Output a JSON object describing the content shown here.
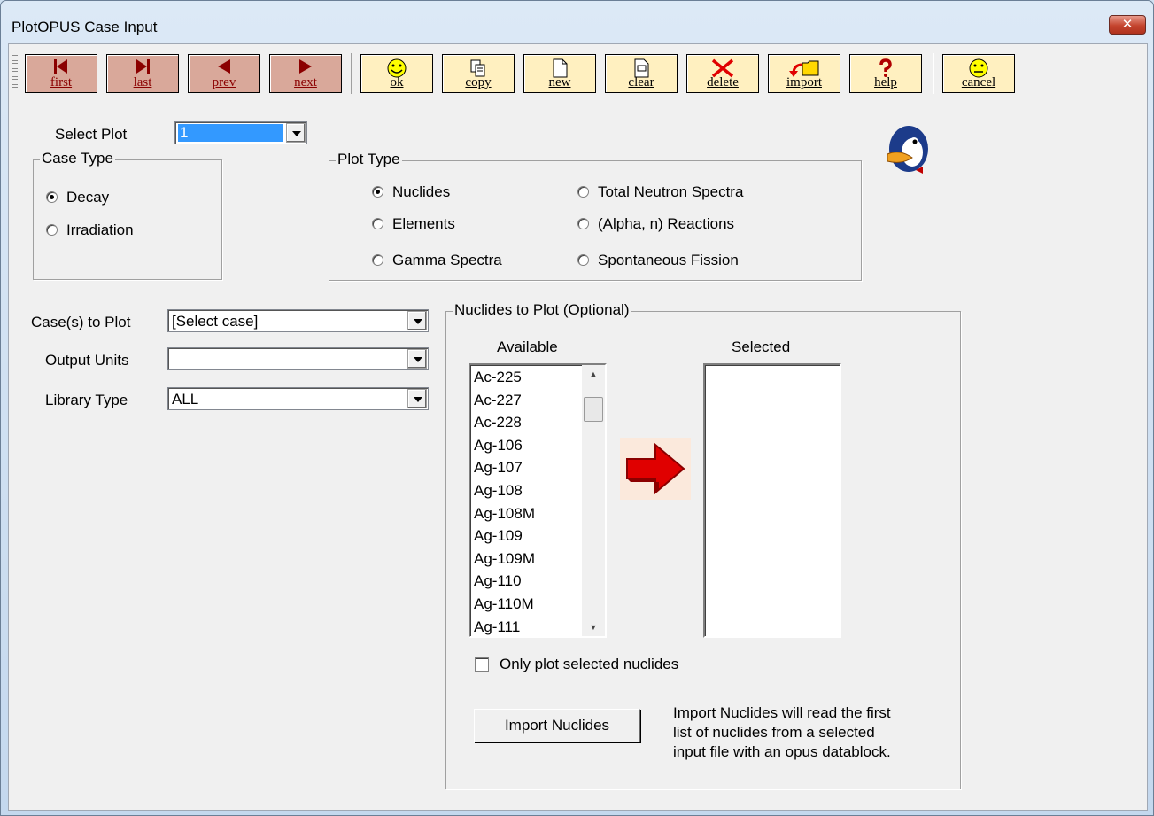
{
  "window": {
    "title": "PlotOPUS Case Input",
    "close_glyph": "✕"
  },
  "toolbar": {
    "buttons": [
      {
        "id": "first",
        "label": "first",
        "icon": "skip-first-icon"
      },
      {
        "id": "last",
        "label": "last",
        "icon": "skip-last-icon"
      },
      {
        "id": "prev",
        "label": "prev",
        "icon": "arrow-left-icon"
      },
      {
        "id": "next",
        "label": "next",
        "icon": "arrow-right-icon"
      },
      {
        "id": "ok",
        "label": "ok",
        "icon": "smiley-icon"
      },
      {
        "id": "copy",
        "label": "copy",
        "icon": "copy-icon"
      },
      {
        "id": "new",
        "label": "new",
        "icon": "new-document-icon"
      },
      {
        "id": "clear",
        "label": "clear",
        "icon": "clear-document-icon"
      },
      {
        "id": "delete",
        "label": "delete",
        "icon": "red-x-icon"
      },
      {
        "id": "import",
        "label": "import",
        "icon": "import-folder-icon"
      },
      {
        "id": "help",
        "label": "help",
        "icon": "question-mark-icon"
      },
      {
        "id": "cancel",
        "label": "cancel",
        "icon": "neutral-face-icon"
      }
    ]
  },
  "select_plot": {
    "label": "Select Plot",
    "value": "1"
  },
  "case_type": {
    "legend": "Case Type",
    "options": [
      {
        "label": "Decay",
        "checked": true
      },
      {
        "label": "Irradiation",
        "checked": false
      }
    ]
  },
  "plot_type": {
    "legend": "Plot Type",
    "options": [
      {
        "label": "Nuclides",
        "checked": true
      },
      {
        "label": "Elements",
        "checked": false
      },
      {
        "label": "Gamma Spectra",
        "checked": false
      },
      {
        "label": "Total Neutron Spectra",
        "checked": false
      },
      {
        "label": "(Alpha, n)  Reactions",
        "checked": false
      },
      {
        "label": "Spontaneous Fission",
        "checked": false
      }
    ]
  },
  "fields": {
    "cases_label": "Case(s) to Plot",
    "cases_value": "[Select case]",
    "units_label": "Output Units",
    "units_value": "",
    "library_label": "Library Type",
    "library_value": "ALL"
  },
  "nuclides": {
    "legend": "Nuclides to Plot  (Optional)",
    "available_label": "Available",
    "selected_label": "Selected",
    "available": [
      "Ac-225",
      "Ac-227",
      "Ac-228",
      "Ag-106",
      "Ag-107",
      "Ag-108",
      "Ag-108M",
      "Ag-109",
      "Ag-109M",
      "Ag-110",
      "Ag-110M",
      "Ag-111"
    ],
    "selected": [],
    "only_selected_label": "Only plot selected nuclides",
    "only_selected_checked": false,
    "import_button": "Import Nuclides",
    "import_help": [
      "Import Nuclides will read the first",
      "list of nuclides from a selected",
      "input file with an opus datablock."
    ]
  },
  "colors": {
    "nav_button": "#d9a89a",
    "action_button": "#fff0c0",
    "arrow": "#e00000",
    "selection": "#3399ff"
  }
}
